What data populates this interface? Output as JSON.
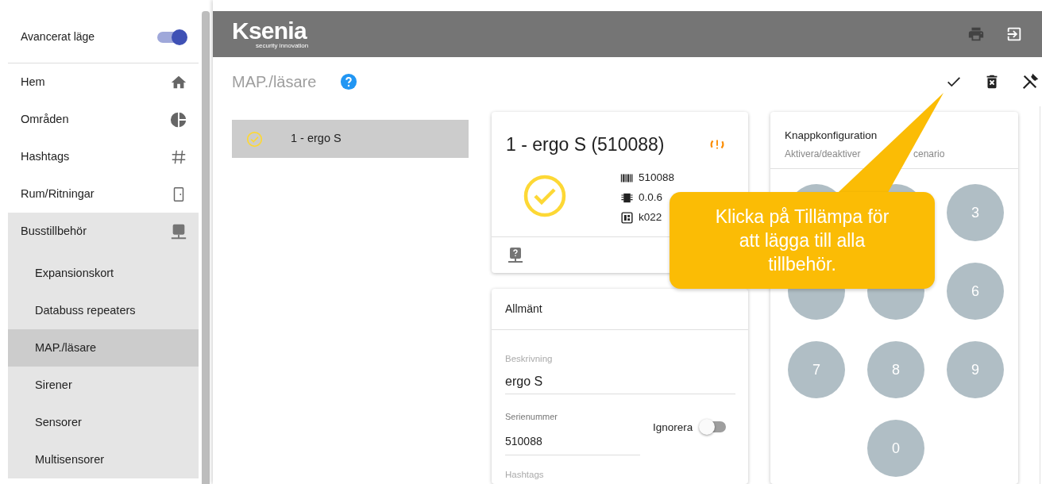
{
  "sidebar": {
    "advanced_mode": {
      "label": "Avancerat läge",
      "on": true
    },
    "items": [
      {
        "label": "Hem",
        "selected": false,
        "expanded": false
      },
      {
        "label": "Områden",
        "selected": false,
        "expanded": false
      },
      {
        "label": "Hashtags",
        "selected": false,
        "expanded": false
      },
      {
        "label": "Rum/Ritningar",
        "selected": false,
        "expanded": false
      },
      {
        "label": "Busstillbehör",
        "selected": false,
        "expanded": true,
        "children": [
          {
            "label": "Expansionskort",
            "selected": false
          },
          {
            "label": "Databuss repeaters",
            "selected": false
          },
          {
            "label": "MAP./läsare",
            "selected": true
          },
          {
            "label": "Sirener",
            "selected": false
          },
          {
            "label": "Sensorer",
            "selected": false
          },
          {
            "label": "Multisensorer",
            "selected": false
          }
        ]
      }
    ]
  },
  "header": {
    "logo": "Ksenia",
    "logo_tagline": "security innovation"
  },
  "page": {
    "title": "MAP./läsare"
  },
  "device_list": [
    {
      "label": "1 - ergo S",
      "selected": true
    }
  ],
  "device_card": {
    "title": "1 - ergo S (510088)",
    "info": [
      {
        "text": "510088"
      },
      {
        "text": "0.0.6"
      },
      {
        "text": "k022"
      }
    ]
  },
  "general_card": {
    "title": "Allmänt",
    "description": {
      "label": "Beskrivning",
      "value": "ergo S"
    },
    "serial": {
      "label": "Serienummer",
      "value": "510088"
    },
    "ignore": {
      "label": "Ignorera",
      "on": false
    },
    "hashtags": {
      "label": "Hashtags"
    }
  },
  "keypad_card": {
    "title": "Knappkonfiguration",
    "subtitle_parts": [
      "Aktivera/deaktiver",
      "cenario"
    ],
    "keys": [
      {
        "kind": "covered"
      },
      {
        "kind": "covered"
      },
      {
        "kind": "digit",
        "label": "3"
      },
      {
        "kind": "covered"
      },
      {
        "kind": "covered"
      },
      {
        "kind": "digit",
        "label": "6"
      },
      {
        "kind": "digit",
        "label": "7"
      },
      {
        "kind": "digit",
        "label": "8"
      },
      {
        "kind": "digit",
        "label": "9"
      },
      {
        "kind": "digit",
        "label": "0"
      }
    ]
  },
  "callout": {
    "text": "Klicka på Tillämpa för att lägga till alla tillbehör."
  }
}
